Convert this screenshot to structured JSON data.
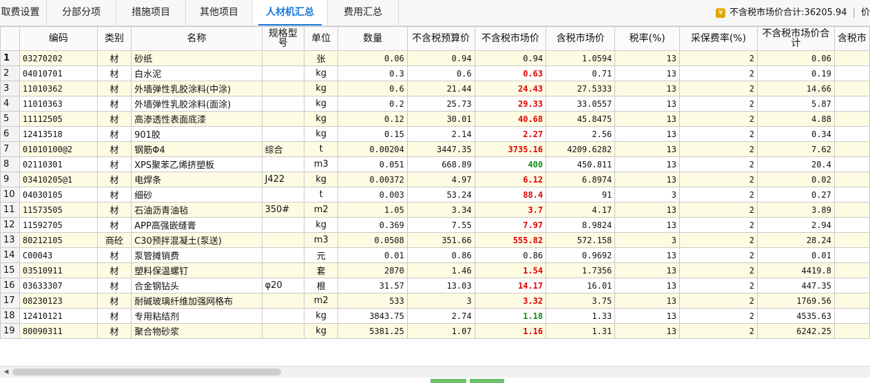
{
  "tabs": [
    {
      "label": "取费设置",
      "active": false
    },
    {
      "label": "分部分项",
      "active": false
    },
    {
      "label": "措施项目",
      "active": false
    },
    {
      "label": "其他项目",
      "active": false
    },
    {
      "label": "人材机汇总",
      "active": true
    },
    {
      "label": "费用汇总",
      "active": false
    }
  ],
  "total_label": "不含税市场价合计:36205.94",
  "total_next": "价",
  "columns": [
    "",
    "编码",
    "类别",
    "名称",
    "规格型号",
    "单位",
    "数量",
    "不含税预算价",
    "不含税市场价",
    "含税市场价",
    "税率(%)",
    "采保费率(%)",
    "不含税市场价合计",
    "含税市"
  ],
  "rows": [
    {
      "no": "1",
      "code": "03270202",
      "cat": "材",
      "name": "砂纸",
      "spec": "",
      "unit": "张",
      "qty": "0.06",
      "budget": "0.94",
      "market": "0.94",
      "market_tax": "1.0594",
      "tax": "13",
      "fee": "2",
      "total": "0.06",
      "mark": ""
    },
    {
      "no": "2",
      "code": "04010701",
      "cat": "材",
      "name": "白水泥",
      "spec": "",
      "unit": "kg",
      "qty": "0.3",
      "budget": "0.6",
      "market": "0.63",
      "market_tax": "0.71",
      "tax": "13",
      "fee": "2",
      "total": "0.19",
      "mark": "red"
    },
    {
      "no": "3",
      "code": "11010362",
      "cat": "材",
      "name": "外墙弹性乳胶涂料(中涂)",
      "spec": "",
      "unit": "kg",
      "qty": "0.6",
      "budget": "21.44",
      "market": "24.43",
      "market_tax": "27.5333",
      "tax": "13",
      "fee": "2",
      "total": "14.66",
      "mark": "red"
    },
    {
      "no": "4",
      "code": "11010363",
      "cat": "材",
      "name": "外墙弹性乳胶涂料(面涂)",
      "spec": "",
      "unit": "kg",
      "qty": "0.2",
      "budget": "25.73",
      "market": "29.33",
      "market_tax": "33.0557",
      "tax": "13",
      "fee": "2",
      "total": "5.87",
      "mark": "red"
    },
    {
      "no": "5",
      "code": "11112505",
      "cat": "材",
      "name": "高渗透性表面底漆",
      "spec": "",
      "unit": "kg",
      "qty": "0.12",
      "budget": "30.01",
      "market": "40.68",
      "market_tax": "45.8475",
      "tax": "13",
      "fee": "2",
      "total": "4.88",
      "mark": "red"
    },
    {
      "no": "6",
      "code": "12413518",
      "cat": "材",
      "name": "901胶",
      "spec": "",
      "unit": "kg",
      "qty": "0.15",
      "budget": "2.14",
      "market": "2.27",
      "market_tax": "2.56",
      "tax": "13",
      "fee": "2",
      "total": "0.34",
      "mark": "red"
    },
    {
      "no": "7",
      "code": "01010100@2",
      "cat": "材",
      "name": "钢筋Φ4",
      "spec": "综合",
      "unit": "t",
      "qty": "0.00204",
      "budget": "3447.35",
      "market": "3735.16",
      "market_tax": "4209.6282",
      "tax": "13",
      "fee": "2",
      "total": "7.62",
      "mark": "red"
    },
    {
      "no": "8",
      "code": "02110301",
      "cat": "材",
      "name": "XPS聚苯乙烯挤塑板",
      "spec": "",
      "unit": "m3",
      "qty": "0.051",
      "budget": "668.89",
      "market": "400",
      "market_tax": "450.811",
      "tax": "13",
      "fee": "2",
      "total": "20.4",
      "mark": "green"
    },
    {
      "no": "9",
      "code": "03410205@1",
      "cat": "材",
      "name": "电焊条",
      "spec": "J422",
      "unit": "kg",
      "qty": "0.00372",
      "budget": "4.97",
      "market": "6.12",
      "market_tax": "6.8974",
      "tax": "13",
      "fee": "2",
      "total": "0.02",
      "mark": "red"
    },
    {
      "no": "10",
      "code": "04030105",
      "cat": "材",
      "name": "细砂",
      "spec": "",
      "unit": "t",
      "qty": "0.003",
      "budget": "53.24",
      "market": "88.4",
      "market_tax": "91",
      "tax": "3",
      "fee": "2",
      "total": "0.27",
      "mark": "red"
    },
    {
      "no": "11",
      "code": "11573505",
      "cat": "材",
      "name": "石油沥青油毡",
      "spec": "350#",
      "unit": "m2",
      "qty": "1.05",
      "budget": "3.34",
      "market": "3.7",
      "market_tax": "4.17",
      "tax": "13",
      "fee": "2",
      "total": "3.89",
      "mark": "red"
    },
    {
      "no": "12",
      "code": "11592705",
      "cat": "材",
      "name": "APP高强嵌缝膏",
      "spec": "",
      "unit": "kg",
      "qty": "0.369",
      "budget": "7.55",
      "market": "7.97",
      "market_tax": "8.9824",
      "tax": "13",
      "fee": "2",
      "total": "2.94",
      "mark": "red"
    },
    {
      "no": "13",
      "code": "80212105",
      "cat": "商砼",
      "name": "C30预拌混凝土(泵送)",
      "spec": "",
      "unit": "m3",
      "qty": "0.0508",
      "budget": "351.66",
      "market": "555.82",
      "market_tax": "572.158",
      "tax": "3",
      "fee": "2",
      "total": "28.24",
      "mark": "red"
    },
    {
      "no": "14",
      "code": "C00043",
      "cat": "材",
      "name": "泵管摊销费",
      "spec": "",
      "unit": "元",
      "qty": "0.01",
      "budget": "0.86",
      "market": "0.86",
      "market_tax": "0.9692",
      "tax": "13",
      "fee": "2",
      "total": "0.01",
      "mark": ""
    },
    {
      "no": "15",
      "code": "03510911",
      "cat": "材",
      "name": "塑料保温螺钉",
      "spec": "",
      "unit": "套",
      "qty": "2870",
      "budget": "1.46",
      "market": "1.54",
      "market_tax": "1.7356",
      "tax": "13",
      "fee": "2",
      "total": "4419.8",
      "mark": "red"
    },
    {
      "no": "16",
      "code": "03633307",
      "cat": "材",
      "name": "合金钢钻头",
      "spec": "φ20",
      "unit": "根",
      "qty": "31.57",
      "budget": "13.03",
      "market": "14.17",
      "market_tax": "16.01",
      "tax": "13",
      "fee": "2",
      "total": "447.35",
      "mark": "red"
    },
    {
      "no": "17",
      "code": "08230123",
      "cat": "材",
      "name": "耐碱玻璃纤维加强网格布",
      "spec": "",
      "unit": "m2",
      "qty": "533",
      "budget": "3",
      "market": "3.32",
      "market_tax": "3.75",
      "tax": "13",
      "fee": "2",
      "total": "1769.56",
      "mark": "red"
    },
    {
      "no": "18",
      "code": "12410121",
      "cat": "材",
      "name": "专用粘结剂",
      "spec": "",
      "unit": "kg",
      "qty": "3843.75",
      "budget": "2.74",
      "market": "1.18",
      "market_tax": "1.33",
      "tax": "13",
      "fee": "2",
      "total": "4535.63",
      "mark": "green"
    },
    {
      "no": "19",
      "code": "80090311",
      "cat": "材",
      "name": "聚合物砂浆",
      "spec": "",
      "unit": "kg",
      "qty": "5381.25",
      "budget": "1.07",
      "market": "1.16",
      "market_tax": "1.31",
      "tax": "13",
      "fee": "2",
      "total": "6242.25",
      "mark": "red"
    }
  ],
  "scroll_left_arrow": "◀"
}
